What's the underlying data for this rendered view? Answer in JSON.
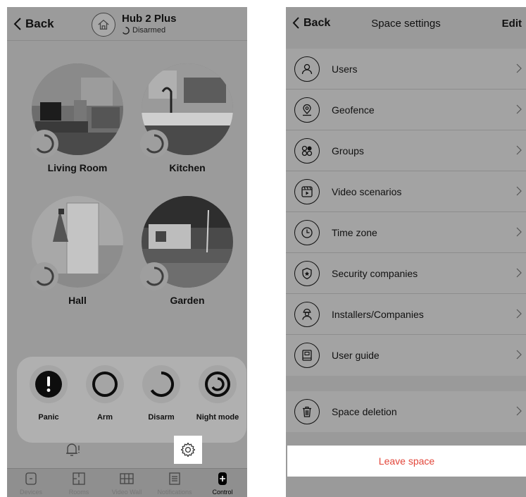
{
  "left": {
    "header": {
      "back_label": "Back",
      "hub_name": "Hub 2 Plus",
      "hub_status": "Disarmed"
    },
    "rooms": [
      {
        "label": "Living Room"
      },
      {
        "label": "Kitchen"
      },
      {
        "label": "Hall"
      },
      {
        "label": "Garden"
      }
    ],
    "controls": [
      {
        "label": "Panic"
      },
      {
        "label": "Arm"
      },
      {
        "label": "Disarm"
      },
      {
        "label": "Night mode"
      }
    ],
    "tabs": [
      {
        "label": "Devices",
        "icon": "devices-icon"
      },
      {
        "label": "Rooms",
        "icon": "rooms-icon"
      },
      {
        "label": "Video Wall",
        "icon": "video-wall-icon"
      },
      {
        "label": "Notifications",
        "icon": "notifications-icon"
      },
      {
        "label": "Control",
        "icon": "control-icon",
        "active": true
      }
    ]
  },
  "right": {
    "header": {
      "back_label": "Back",
      "title": "Space settings",
      "edit_label": "Edit"
    },
    "settings": [
      {
        "label": "Users",
        "icon": "user-icon"
      },
      {
        "label": "Geofence",
        "icon": "geofence-icon"
      },
      {
        "label": "Groups",
        "icon": "groups-icon"
      },
      {
        "label": "Video scenarios",
        "icon": "video-scenarios-icon"
      },
      {
        "label": "Time zone",
        "icon": "clock-icon"
      },
      {
        "label": "Security companies",
        "icon": "security-shield-icon"
      },
      {
        "label": "Installers/Companies",
        "icon": "installer-icon"
      },
      {
        "label": "User guide",
        "icon": "book-icon"
      }
    ],
    "danger_settings": [
      {
        "label": "Space deletion",
        "icon": "trash-icon"
      }
    ],
    "leave_label": "Leave space",
    "colors": {
      "leave_text": "#e2463a"
    }
  }
}
